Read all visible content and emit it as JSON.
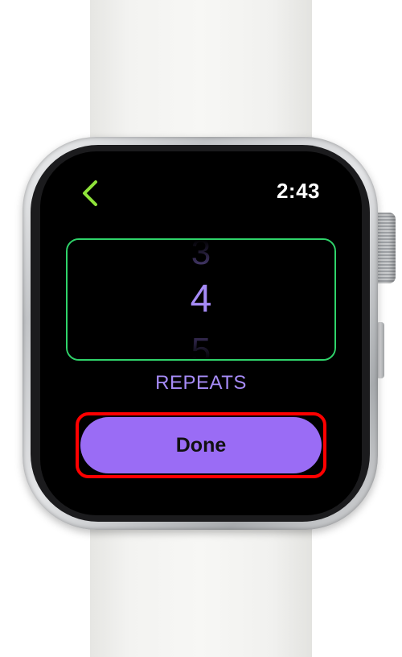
{
  "status_bar": {
    "time": "2:43"
  },
  "navigation": {
    "back_icon": "chevron-left-icon",
    "back_color": "#8fe33a"
  },
  "picker": {
    "previous_value": "3",
    "current_value": "4",
    "next_value": "5",
    "label": "REPEATS",
    "border_color": "#2fd36a",
    "text_color": "#a68bf7"
  },
  "actions": {
    "done_label": "Done",
    "done_color": "#9a6cf5",
    "highlight_color": "#ff0000"
  }
}
